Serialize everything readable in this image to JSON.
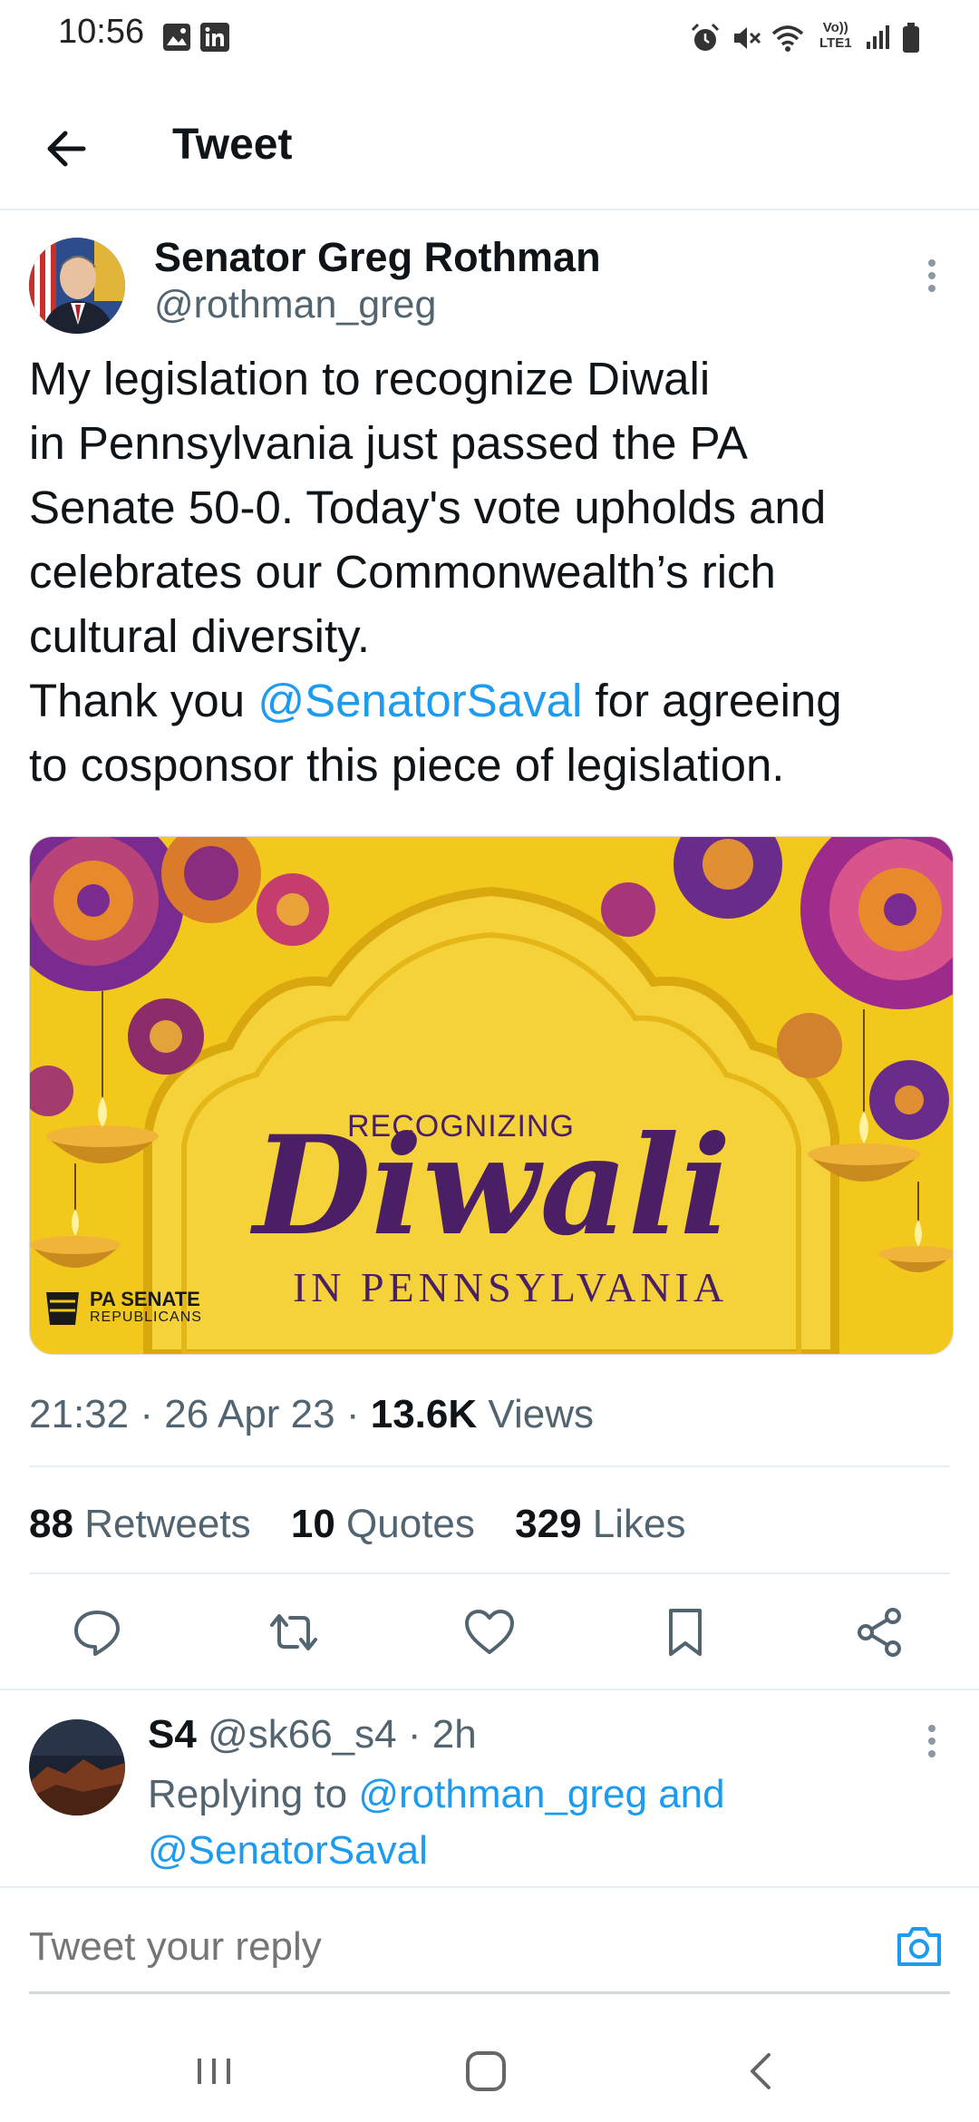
{
  "status_bar": {
    "time": "10:56",
    "left_icons": [
      "gallery-icon",
      "linkedin-icon"
    ],
    "right_icons": [
      "alarm-icon",
      "mute-icon",
      "wifi-icon",
      "volte-icon",
      "signal-icon",
      "battery-icon"
    ],
    "volte_label": "Vo))\nLTE1"
  },
  "header": {
    "title": "Tweet"
  },
  "tweet": {
    "author_name": "Senator Greg Rothman",
    "author_handle": "@rothman_greg",
    "text_lines": [
      "My legislation to recognize Diwali",
      "in Pennsylvania just passed the PA",
      "Senate 50-0. Today's vote upholds and",
      "celebrates our Commonwealth’s rich",
      "cultural diversity."
    ],
    "thanks_prefix": "Thank you ",
    "thanks_mention": "@SenatorSaval",
    "thanks_suffix": " for agreeing",
    "thanks_line2": "to cosponsor this piece of legislation.",
    "image": {
      "small_title": "RECOGNIZING",
      "big_title": "Diwali",
      "subtitle": "IN PENNSYLVANIA",
      "logo_line1": "PA SENATE",
      "logo_line2": "REPUBLICANS"
    },
    "time": "21:32",
    "date": "26 Apr 23",
    "views_count": "13.6K",
    "views_label": "Views",
    "retweets_count": "88",
    "retweets_label": "Retweets",
    "quotes_count": "10",
    "quotes_label": "Quotes",
    "likes_count": "329",
    "likes_label": "Likes"
  },
  "reply": {
    "name": "S4",
    "handle": "@sk66_s4",
    "age": "2h",
    "replying_prefix": "Replying to ",
    "replying_mention1": "@rothman_greg",
    "replying_and": " and",
    "replying_mention2": "@SenatorSaval"
  },
  "composer": {
    "placeholder": "Tweet your reply"
  },
  "colors": {
    "accent": "#1d9bf0",
    "image_bg": "#f2c81c",
    "diwali_purple": "#4a1f66"
  }
}
